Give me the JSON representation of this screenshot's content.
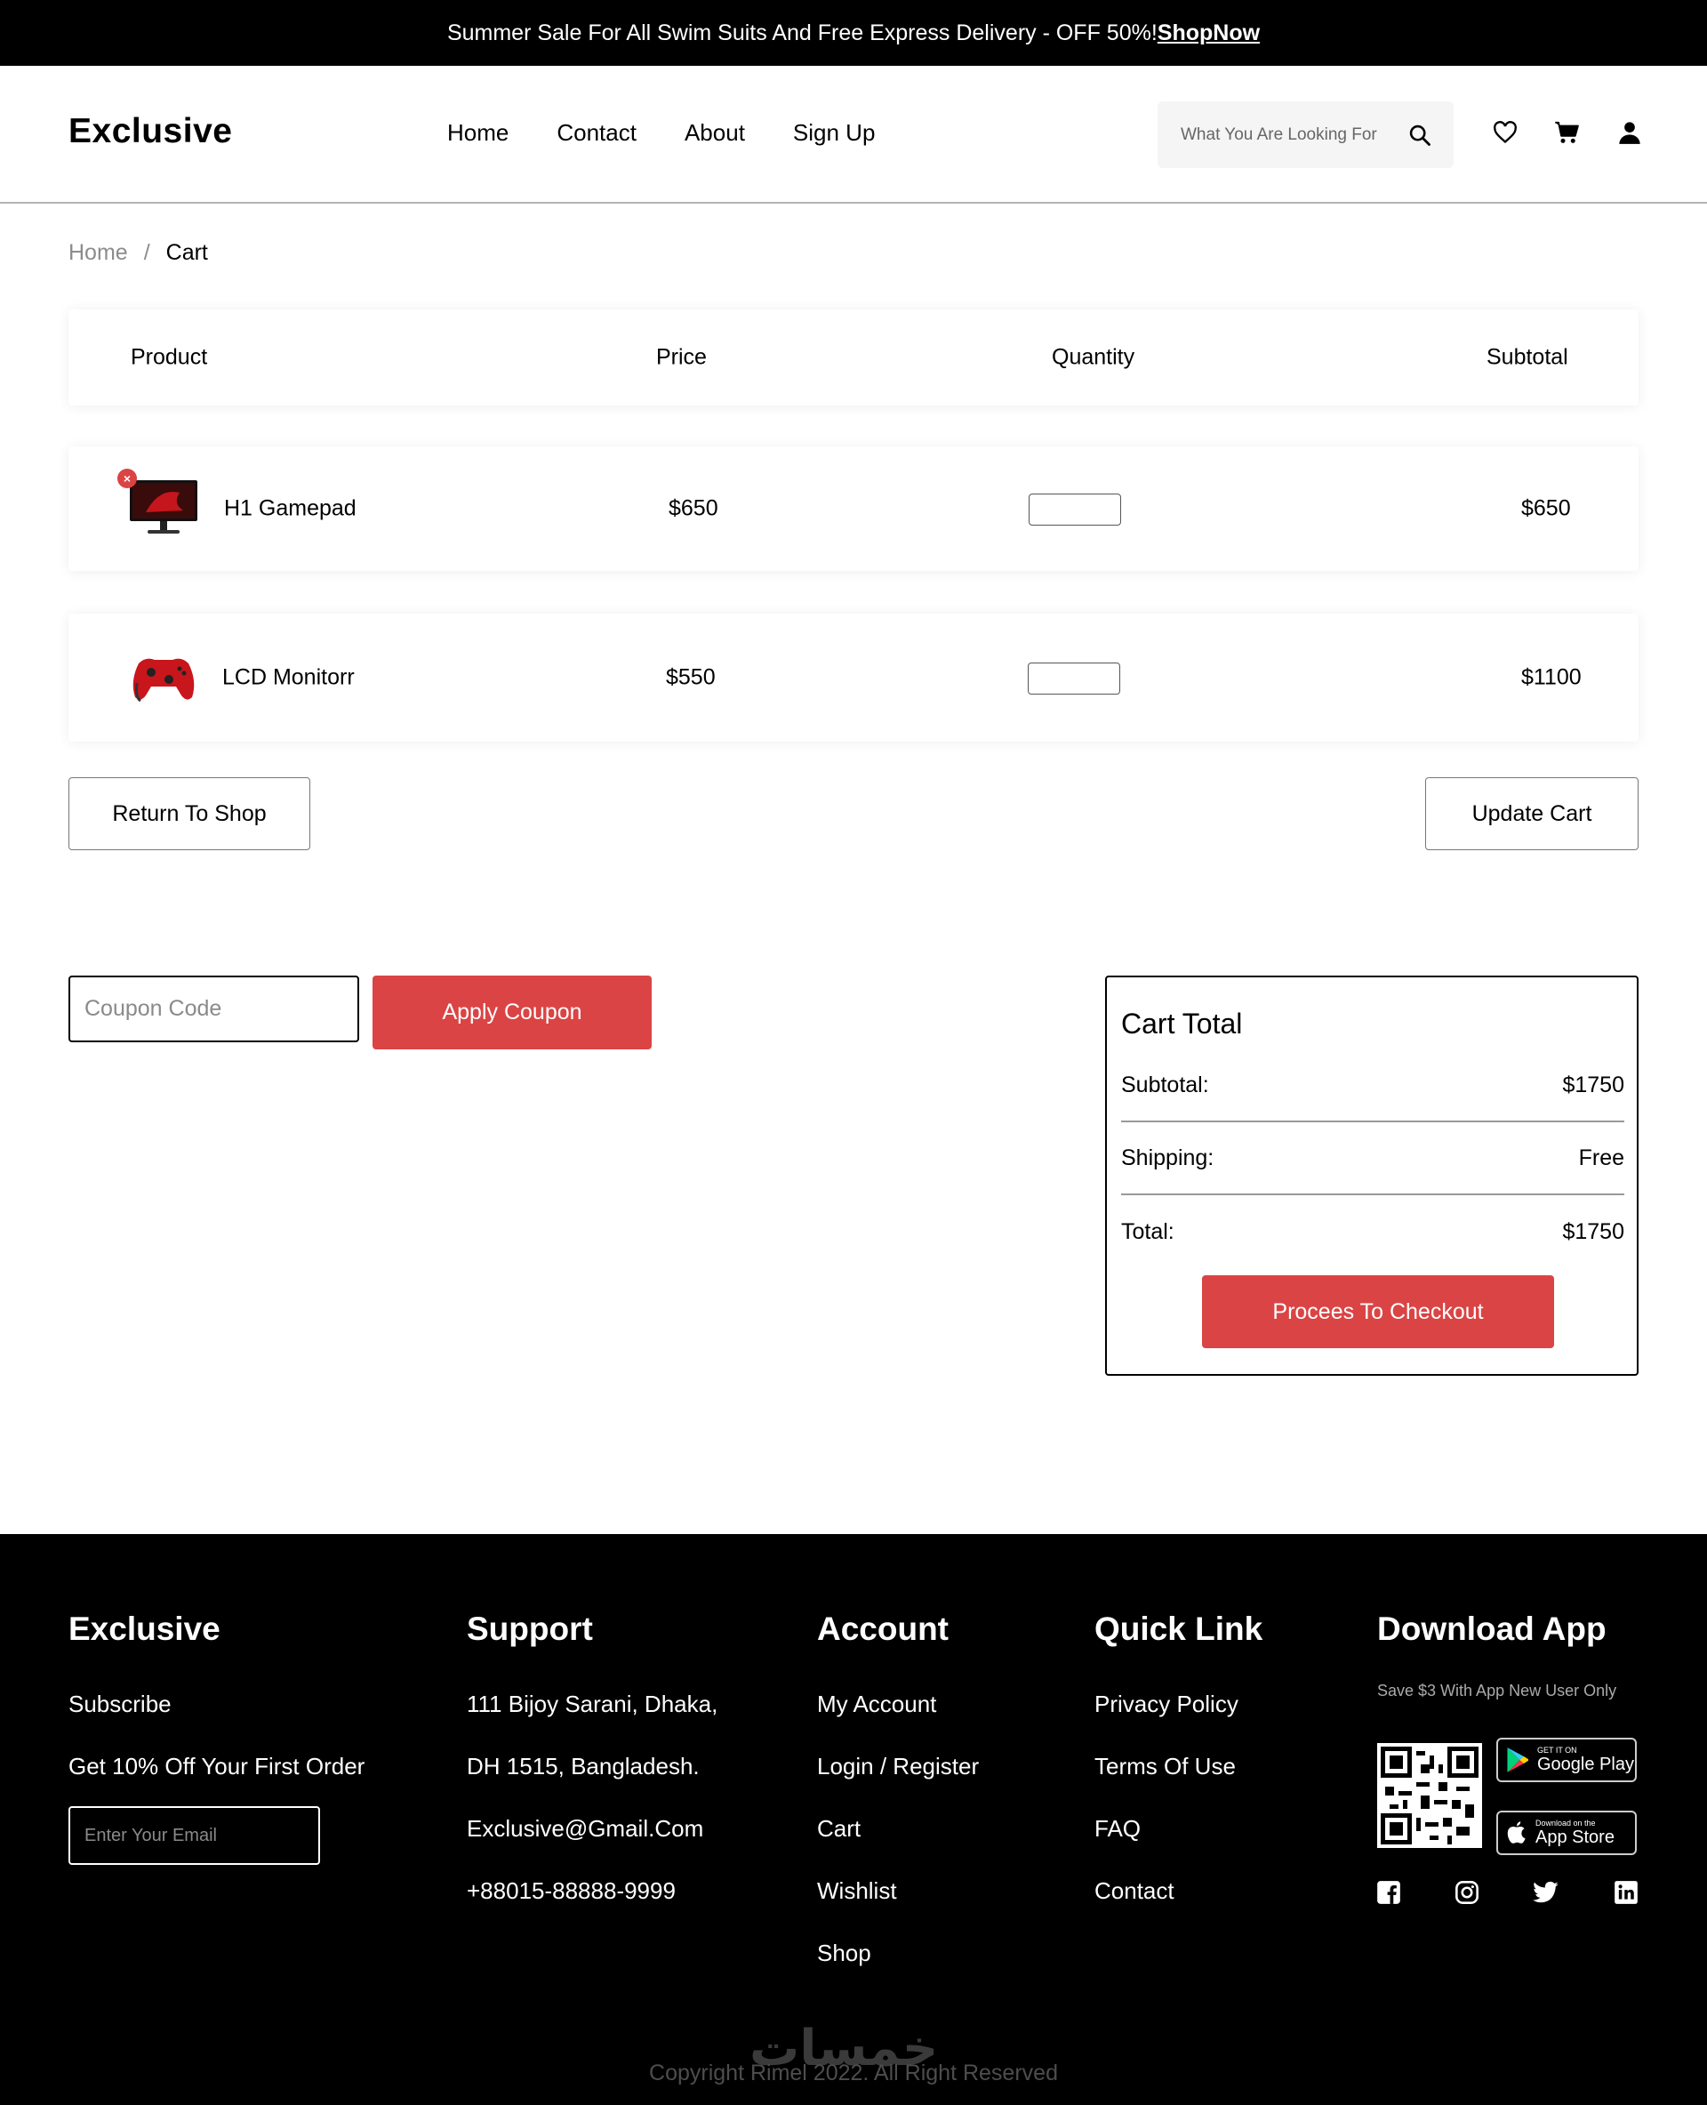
{
  "banner": {
    "text": "Summer Sale For All Swim Suits And Free Express Delivery - OFF 50%!",
    "link": "ShopNow"
  },
  "header": {
    "logo": "Exclusive",
    "nav": [
      "Home",
      "Contact",
      "About",
      "Sign Up"
    ],
    "search_placeholder": "What You Are Looking For",
    "icons": [
      "search-icon",
      "heart-icon",
      "cart-icon",
      "user-icon"
    ]
  },
  "breadcrumb": {
    "home": "Home",
    "separator": "/",
    "current": "Cart"
  },
  "cart": {
    "columns": [
      "Product",
      "Price",
      "Quantity",
      "Subtotal"
    ],
    "items": [
      {
        "name": "H1 Gamepad",
        "price": "$650",
        "subtotal": "$650",
        "thumb": "monitor-image",
        "removable": true
      },
      {
        "name": "LCD Monitorr",
        "price": "$550",
        "subtotal": "$1100",
        "thumb": "gamepad-image",
        "removable": false
      }
    ],
    "return_label": "Return To Shop",
    "update_label": "Update Cart"
  },
  "coupon": {
    "placeholder": "Coupon Code",
    "button": "Apply Coupon"
  },
  "cart_total": {
    "title": "Cart Total",
    "subtotal_label": "Subtotal:",
    "subtotal_value": "$1750",
    "shipping_label": "Shipping:",
    "shipping_value": "Free",
    "total_label": "Total:",
    "total_value": "$1750",
    "checkout_label": "Procees To Checkout"
  },
  "footer": {
    "brand": {
      "title": "Exclusive",
      "subscribe": "Subscribe",
      "offer": "Get 10% Off Your First Order",
      "email_placeholder": "Enter Your Email"
    },
    "support": {
      "title": "Support",
      "items": [
        "111 Bijoy Sarani, Dhaka,",
        "DH 1515, Bangladesh.",
        "Exclusive@Gmail.Com",
        "+88015-88888-9999"
      ]
    },
    "account": {
      "title": "Account",
      "items": [
        "My Account",
        "Login / Register",
        "Cart",
        "Wishlist",
        "Shop"
      ]
    },
    "quick_link": {
      "title": "Quick Link",
      "items": [
        "Privacy Policy",
        "Terms Of Use",
        "FAQ",
        "Contact"
      ]
    },
    "download": {
      "title": "Download App",
      "note": "Save $3 With App New User Only",
      "google_small": "GET IT ON",
      "google_big": "Google Play",
      "apple_small": "Download on the",
      "apple_big": "App Store",
      "socials": [
        "facebook-icon",
        "instagram-icon",
        "twitter-icon",
        "linkedin-icon"
      ]
    },
    "copyright": "Copyright Rimel 2022. All Right Reserved",
    "watermark": "خمسات"
  },
  "colors": {
    "accent": "#DB4444",
    "footer_bg": "#000000"
  }
}
